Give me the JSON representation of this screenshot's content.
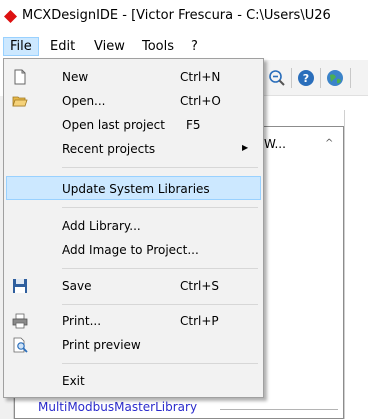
{
  "window": {
    "title": "MCXDesignIDE - [Victor Frescura - C:\\Users\\U26"
  },
  "menubar": [
    {
      "label": "File"
    },
    {
      "label": "Edit"
    },
    {
      "label": "View"
    },
    {
      "label": "Tools"
    },
    {
      "label": "?"
    }
  ],
  "file_menu": {
    "items": [
      {
        "label": "New",
        "shortcut": "Ctrl+N",
        "icon": "new-document-icon"
      },
      {
        "label": "Open...",
        "shortcut": "Ctrl+O",
        "icon": "open-folder-icon"
      },
      {
        "label": "Open last project",
        "shortcut": "F5"
      },
      {
        "label": "Recent projects",
        "submenu": true
      },
      {
        "label": "Update System Libraries",
        "highlighted": true
      },
      {
        "label": "Add Library..."
      },
      {
        "label": "Add Image to Project..."
      },
      {
        "label": "Save",
        "shortcut": "Ctrl+S",
        "icon": "save-icon"
      },
      {
        "label": "Print...",
        "shortcut": "Ctrl+P",
        "icon": "print-icon"
      },
      {
        "label": "Print preview",
        "icon": "print-preview-icon"
      },
      {
        "label": "Exit"
      }
    ]
  },
  "panel": {
    "header_fragment": "W...",
    "bottom_item": "MultiModbusMasterLibrary"
  },
  "toolbar_icons": [
    "zoom-out-icon",
    "help-icon",
    "globe-icon"
  ],
  "colors": {
    "highlight": "#cce8ff",
    "highlight_border": "#99d1ff",
    "menu_bg": "#f2f2f2",
    "link_blue": "#2b2bcc"
  }
}
